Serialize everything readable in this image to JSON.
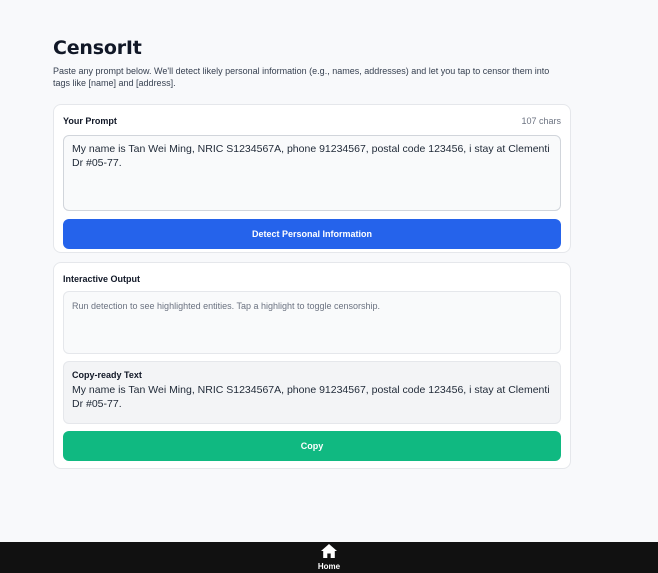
{
  "app": {
    "title": "CensorIt",
    "subtitle": "Paste any prompt below. We'll detect likely personal information (e.g., names, addresses) and let you tap to censor them into tags like [name] and [address]."
  },
  "prompt_card": {
    "label": "Your Prompt",
    "char_count": "107 chars",
    "value": "My name is Tan Wei Ming, NRIC S1234567A, phone 91234567, postal code 123456, i stay at  Clementi Dr #05-77.",
    "detect_label": "Detect Personal Information"
  },
  "output_card": {
    "label": "Interactive Output",
    "placeholder": "Run detection to see highlighted entities. Tap a highlight to toggle censorship.",
    "copy_label": "Copy-ready Text",
    "copy_text": "My name is Tan Wei Ming, NRIC S1234567A, phone 91234567, postal code 123456, i stay at  Clementi Dr #05-77.",
    "copy_button": "Copy"
  },
  "nav": {
    "home_label": "Home",
    "home_icon": "home-icon"
  },
  "colors": {
    "detect_button": "#2563eb",
    "copy_button": "#10b981",
    "nav_background": "#111111"
  }
}
